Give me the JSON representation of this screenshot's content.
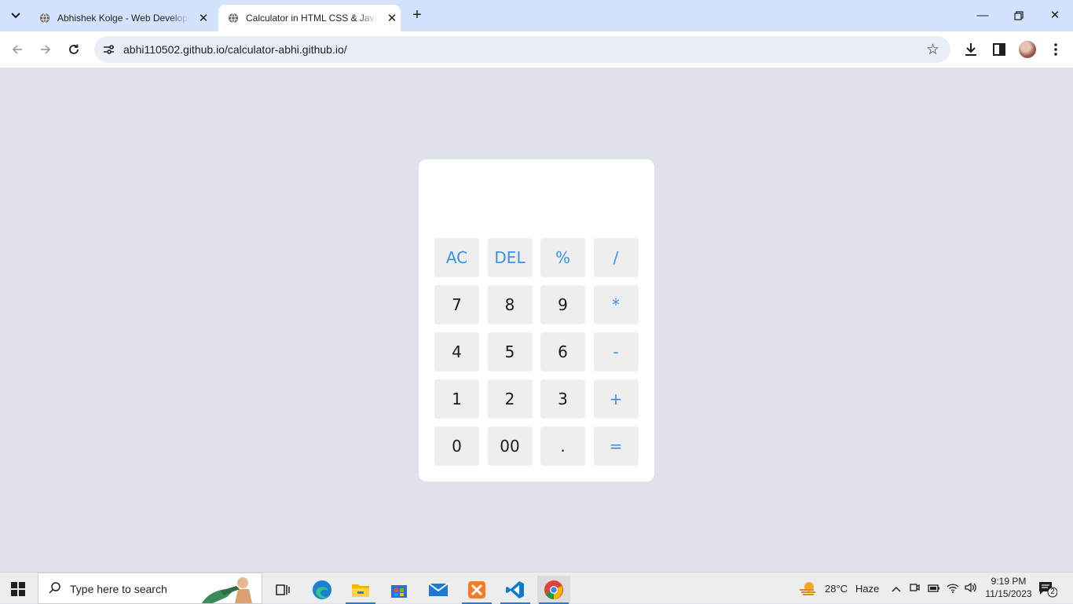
{
  "browser": {
    "tabs": [
      {
        "title": "Abhishek Kolge - Web Developer",
        "active": false
      },
      {
        "title": "Calculator in HTML CSS & JavaScript",
        "active": true
      }
    ],
    "new_tab_label": "+",
    "url": "abhi110502.github.io/calculator-abhi.github.io/",
    "icons": [
      "tab-search-icon",
      "globe-icon",
      "close-icon",
      "back-icon",
      "forward-icon",
      "reload-icon",
      "site-settings-icon",
      "bookmark-star-icon",
      "download-icon",
      "side-panel-icon",
      "profile-avatar",
      "menu-icon"
    ]
  },
  "calculator": {
    "display_value": "",
    "accent_color": "#3a92e6",
    "keys": [
      {
        "label": "AC",
        "type": "op"
      },
      {
        "label": "DEL",
        "type": "op"
      },
      {
        "label": "%",
        "type": "op"
      },
      {
        "label": "/",
        "type": "op"
      },
      {
        "label": "7",
        "type": "num"
      },
      {
        "label": "8",
        "type": "num"
      },
      {
        "label": "9",
        "type": "num"
      },
      {
        "label": "*",
        "type": "op"
      },
      {
        "label": "4",
        "type": "num"
      },
      {
        "label": "5",
        "type": "num"
      },
      {
        "label": "6",
        "type": "num"
      },
      {
        "label": "-",
        "type": "op"
      },
      {
        "label": "1",
        "type": "num"
      },
      {
        "label": "2",
        "type": "num"
      },
      {
        "label": "3",
        "type": "num"
      },
      {
        "label": "+",
        "type": "op"
      },
      {
        "label": "0",
        "type": "num"
      },
      {
        "label": "00",
        "type": "num"
      },
      {
        "label": ".",
        "type": "num"
      },
      {
        "label": "=",
        "type": "op"
      }
    ]
  },
  "taskbar": {
    "search_placeholder": "Type here to search",
    "apps": [
      "task-view-icon",
      "edge-icon",
      "file-explorer-icon",
      "store-icon",
      "mail-icon",
      "xampp-icon",
      "vscode-icon",
      "chrome-icon"
    ],
    "weather": {
      "temp": "28°C",
      "condition": "Haze"
    },
    "time": "9:19 PM",
    "date": "11/15/2023",
    "notification_count": "2"
  }
}
